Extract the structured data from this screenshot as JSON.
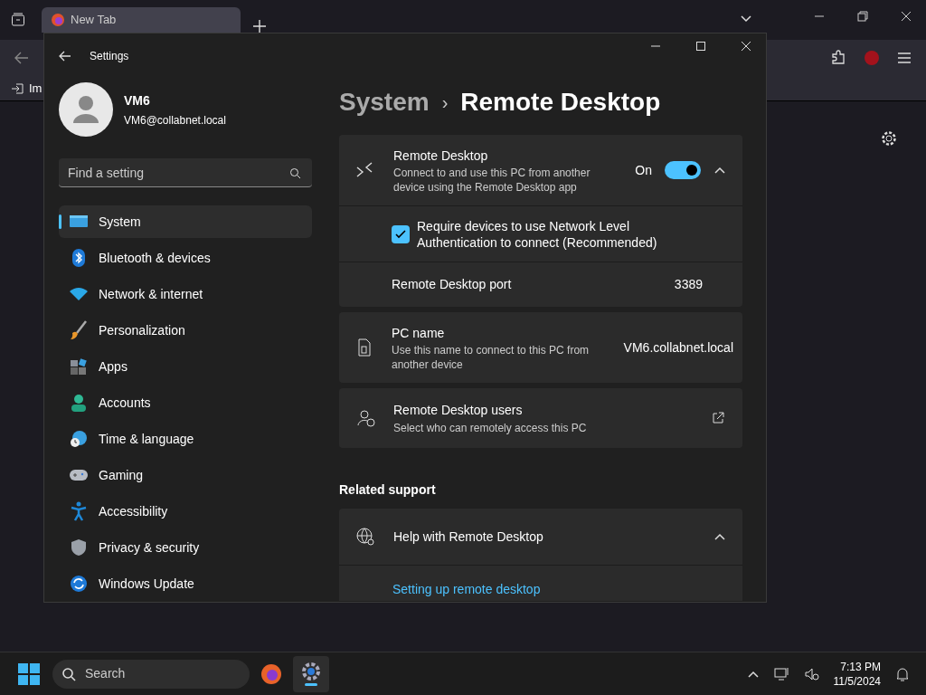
{
  "browser": {
    "tab": {
      "title": "New Tab",
      "selected": true
    },
    "bookmark": "Im"
  },
  "settings": {
    "title": "Settings",
    "user": {
      "name": "VM6",
      "email": "VM6@collabnet.local"
    },
    "search": {
      "placeholder": "Find a setting"
    },
    "nav": [
      {
        "label": "System",
        "selected": true
      },
      {
        "label": "Bluetooth & devices",
        "selected": false
      },
      {
        "label": "Network & internet",
        "selected": false
      },
      {
        "label": "Personalization",
        "selected": false
      },
      {
        "label": "Apps",
        "selected": false
      },
      {
        "label": "Accounts",
        "selected": false
      },
      {
        "label": "Time & language",
        "selected": false
      },
      {
        "label": "Gaming",
        "selected": false
      },
      {
        "label": "Accessibility",
        "selected": false
      },
      {
        "label": "Privacy & security",
        "selected": false
      },
      {
        "label": "Windows Update",
        "selected": false
      }
    ],
    "breadcrumb": {
      "parent": "System",
      "separator": "›",
      "current": "Remote Desktop"
    },
    "remote_desktop": {
      "title": "Remote Desktop",
      "description": "Connect to and use this PC from another device using the Remote Desktop app",
      "state_label": "On",
      "on": true,
      "expanded": true,
      "nla": {
        "label": "Require devices to use Network Level Authentication to connect (Recommended)",
        "checked": true
      },
      "port": {
        "label": "Remote Desktop port",
        "value": "3389"
      }
    },
    "pc_name": {
      "title": "PC name",
      "description": "Use this name to connect to this PC from another device",
      "value": "VM6.collabnet.local"
    },
    "users": {
      "title": "Remote Desktop users",
      "description": "Select who can remotely access this PC"
    },
    "related": {
      "heading": "Related support",
      "help_title": "Help with Remote Desktop",
      "expanded": true,
      "link": "Setting up remote desktop"
    }
  },
  "taskbar": {
    "search": "Search",
    "time": "7:13 PM",
    "date": "11/5/2024"
  }
}
